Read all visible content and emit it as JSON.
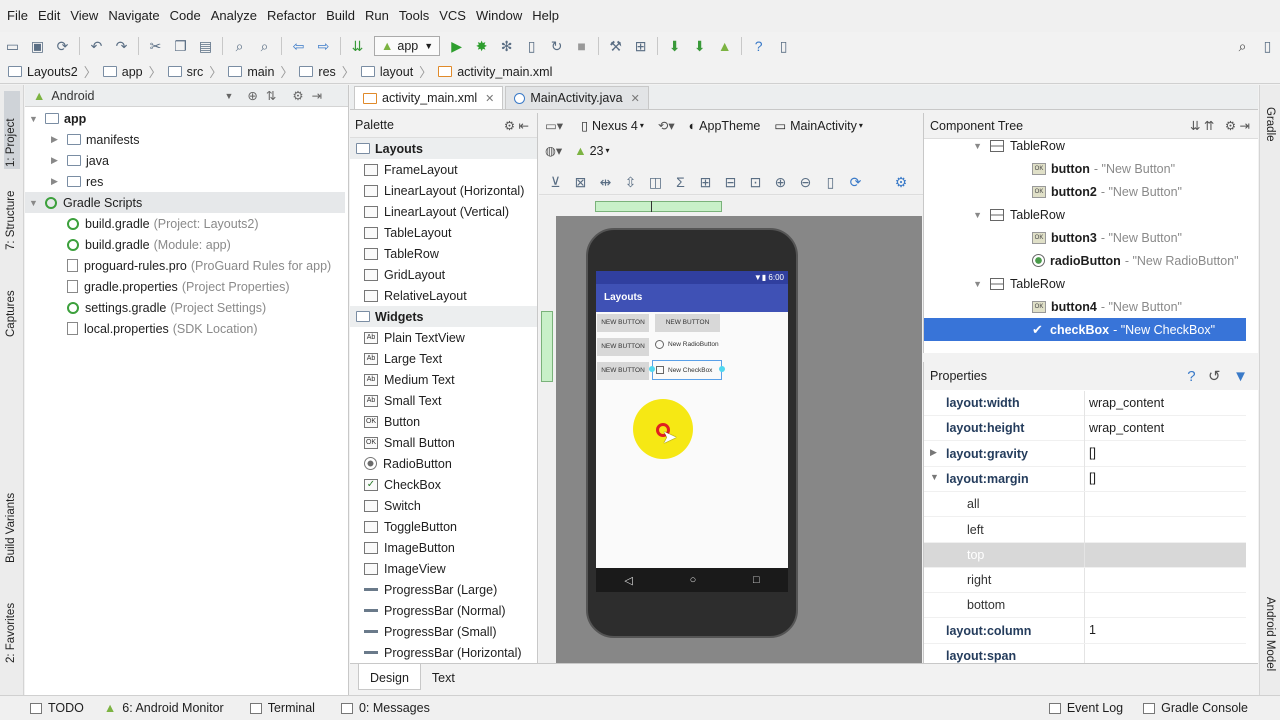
{
  "menu": [
    "File",
    "Edit",
    "View",
    "Navigate",
    "Code",
    "Analyze",
    "Refactor",
    "Build",
    "Run",
    "Tools",
    "VCS",
    "Window",
    "Help"
  ],
  "toolbar": {
    "run_config": "app"
  },
  "breadcrumbs": [
    "Layouts2",
    "app",
    "src",
    "main",
    "res",
    "layout",
    "activity_main.xml"
  ],
  "left_strip": {
    "project": "1: Project",
    "structure": "7: Structure",
    "captures": "Captures",
    "build_variants": "Build Variants",
    "favorites": "2: Favorites"
  },
  "right_strip": {
    "gradle": "Gradle",
    "android_model": "Android Model"
  },
  "project": {
    "view_selector": "Android",
    "tree": [
      {
        "label": "app",
        "hint": "",
        "indent": 0,
        "icon": "folder",
        "bold": true,
        "expanded": true
      },
      {
        "label": "manifests",
        "hint": "",
        "indent": 1,
        "icon": "folder"
      },
      {
        "label": "java",
        "hint": "",
        "indent": 1,
        "icon": "folder"
      },
      {
        "label": "res",
        "hint": "",
        "indent": 1,
        "icon": "folder"
      },
      {
        "label": "Gradle Scripts",
        "hint": "",
        "indent": 0,
        "icon": "gradle",
        "expanded": true
      },
      {
        "label": "build.gradle",
        "hint": "(Project: Layouts2)",
        "indent": 1,
        "icon": "gradle"
      },
      {
        "label": "build.gradle",
        "hint": "(Module: app)",
        "indent": 1,
        "icon": "gradle"
      },
      {
        "label": "proguard-rules.pro",
        "hint": "(ProGuard Rules for app)",
        "indent": 1,
        "icon": "file"
      },
      {
        "label": "gradle.properties",
        "hint": "(Project Properties)",
        "indent": 1,
        "icon": "file"
      },
      {
        "label": "settings.gradle",
        "hint": "(Project Settings)",
        "indent": 1,
        "icon": "gradle"
      },
      {
        "label": "local.properties",
        "hint": "(SDK Location)",
        "indent": 1,
        "icon": "file"
      }
    ]
  },
  "editor_tabs": [
    {
      "label": "activity_main.xml",
      "active": true
    },
    {
      "label": "MainActivity.java",
      "active": false
    }
  ],
  "palette": {
    "title": "Palette",
    "layouts_label": "Layouts",
    "layouts": [
      "FrameLayout",
      "LinearLayout (Horizontal)",
      "LinearLayout (Vertical)",
      "TableLayout",
      "TableRow",
      "GridLayout",
      "RelativeLayout"
    ],
    "widgets_label": "Widgets",
    "widgets": [
      "Plain TextView",
      "Large Text",
      "Medium Text",
      "Small Text",
      "Button",
      "Small Button",
      "RadioButton",
      "CheckBox",
      "Switch",
      "ToggleButton",
      "ImageButton",
      "ImageView",
      "ProgressBar (Large)",
      "ProgressBar (Normal)",
      "ProgressBar (Small)",
      "ProgressBar (Horizontal)"
    ]
  },
  "design_toolbar": {
    "device": "Nexus 4",
    "theme": "AppTheme",
    "activity": "MainActivity",
    "api": "23"
  },
  "phone": {
    "time": "6:00",
    "app_title": "Layouts",
    "buttons": {
      "b1": "NEW BUTTON",
      "b2": "NEW BUTTON",
      "b3": "NEW BUTTON",
      "b4": "NEW BUTTON"
    },
    "radio": "New RadioButton",
    "checkbox": "New CheckBox"
  },
  "component_tree": {
    "title": "Component Tree",
    "rows": [
      {
        "name": "TableRow",
        "value": "",
        "indent": 0,
        "icon": "table"
      },
      {
        "name": "button",
        "value": "- \"New Button\"",
        "indent": 1,
        "icon": "ok"
      },
      {
        "name": "button2",
        "value": "- \"New Button\"",
        "indent": 1,
        "icon": "ok"
      },
      {
        "name": "TableRow",
        "value": "",
        "indent": 0,
        "icon": "table"
      },
      {
        "name": "button3",
        "value": "- \"New Button\"",
        "indent": 1,
        "icon": "ok"
      },
      {
        "name": "radioButton",
        "value": "- \"New RadioButton\"",
        "indent": 1,
        "icon": "radio"
      },
      {
        "name": "TableRow",
        "value": "",
        "indent": 0,
        "icon": "table"
      },
      {
        "name": "button4",
        "value": "- \"New Button\"",
        "indent": 1,
        "icon": "ok"
      },
      {
        "name": "checkBox",
        "value": "- \"New CheckBox\"",
        "indent": 1,
        "icon": "check",
        "selected": true
      }
    ]
  },
  "properties": {
    "title": "Properties",
    "rows": [
      {
        "name": "layout:width",
        "value": "wrap_content"
      },
      {
        "name": "layout:height",
        "value": "wrap_content"
      },
      {
        "name": "layout:gravity",
        "value": "[]",
        "expand": "right"
      },
      {
        "name": "layout:margin",
        "value": "[]",
        "expand": "down"
      },
      {
        "name": "all",
        "value": "",
        "sub": true
      },
      {
        "name": "left",
        "value": "",
        "sub": true
      },
      {
        "name": "top",
        "value": "",
        "sub": true,
        "dim": true
      },
      {
        "name": "right",
        "value": "",
        "sub": true
      },
      {
        "name": "bottom",
        "value": "",
        "sub": true
      },
      {
        "name": "layout:column",
        "value": "1"
      },
      {
        "name": "layout:span",
        "value": ""
      }
    ]
  },
  "design_tabs": [
    {
      "label": "Design",
      "active": true
    },
    {
      "label": "Text",
      "active": false
    }
  ],
  "statusbar": {
    "todo": "TODO",
    "monitor": "6: Android Monitor",
    "terminal": "Terminal",
    "messages": "0: Messages",
    "event_log": "Event Log",
    "gradle_console": "Gradle Console"
  },
  "colors": {
    "selection": "#3874d8",
    "app_bar": "#3f51b5",
    "status_bar": "#303f9f",
    "cursor_highlight": "#f5e600"
  }
}
